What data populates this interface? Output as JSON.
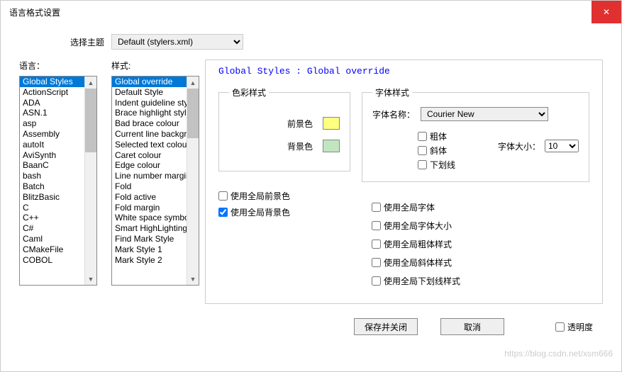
{
  "window": {
    "title": "语言格式设置",
    "close_icon": "✕"
  },
  "theme": {
    "label": "选择主题",
    "value": "Default (stylers.xml)"
  },
  "lists": {
    "language_label": "语言：",
    "style_label": "样式:",
    "languages": [
      "Global Styles",
      "ActionScript",
      "ADA",
      "ASN.1",
      "asp",
      "Assembly",
      "autoIt",
      "AviSynth",
      "BaanC",
      "bash",
      "Batch",
      "BlitzBasic",
      "C",
      "C++",
      "C#",
      "Caml",
      "CMakeFile",
      "COBOL"
    ],
    "styles": [
      "Global override",
      "Default Style",
      "Indent guideline style",
      "Brace highlight style",
      "Bad brace colour",
      "Current line background",
      "Selected text colour",
      "Caret colour",
      "Edge colour",
      "Line number margin",
      "Fold",
      "Fold active",
      "Fold margin",
      "White space symbol",
      "Smart HighLighting",
      "Find Mark Style",
      "Mark Style 1",
      "Mark Style 2"
    ]
  },
  "header": "Global Styles : Global override",
  "color": {
    "legend": "色彩样式",
    "fg_label": "前景色",
    "fg": "#ffff80",
    "bg_label": "背景色",
    "bg": "#c0e6c0"
  },
  "font": {
    "legend": "字体样式",
    "name_label": "字体名称：",
    "name_value": "Courier New",
    "size_label": "字体大小：",
    "size_value": "10",
    "bold": "粗体",
    "italic": "斜体",
    "underline": "下划线"
  },
  "globals_left": {
    "fg": "使用全局前景色",
    "bg": "使用全局背景色"
  },
  "globals_right": {
    "font": "使用全局字体",
    "size": "使用全局字体大小",
    "bold": "使用全局粗体样式",
    "italic": "使用全局斜体样式",
    "underline": "使用全局下划线样式"
  },
  "buttons": {
    "save": "保存并关闭",
    "cancel": "取消",
    "transparent": "透明度"
  },
  "watermark": "https://blog.csdn.net/xsm666"
}
